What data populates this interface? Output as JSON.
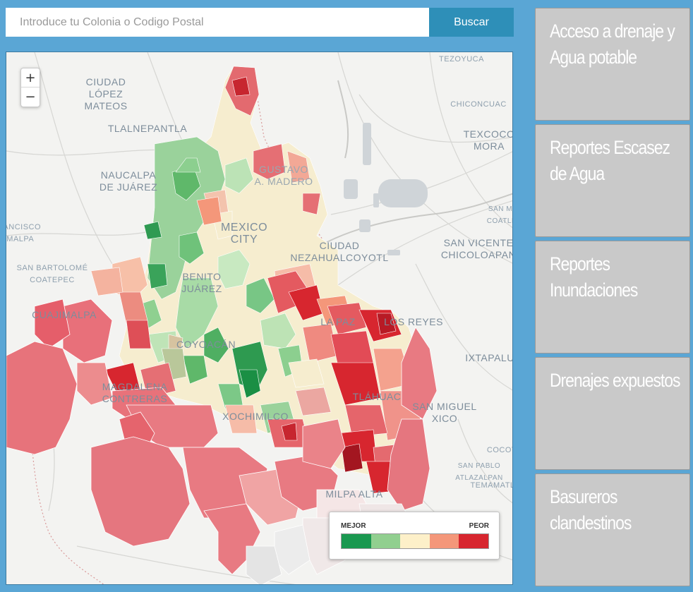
{
  "search": {
    "placeholder": "Introduce tu Colonia o Codigo Postal",
    "button_label": "Buscar"
  },
  "map": {
    "zoom_in_label": "+",
    "zoom_out_label": "−",
    "place_labels": {
      "ciudad_lopez_mateos": "CIUDAD\nLÓPEZ\nMATEOS",
      "tlalnepantla": "TLALNEPANTLA",
      "naucalpan": "NAUCALPA\nDE JUÁREZ",
      "francisco": "RANCISCO\nIMALPA",
      "san_bartolome": "SAN BARTOLOMÉ\nCOATEPEC",
      "cuajimalpa": "CUAJIMALPA",
      "mexico_city": "MEXICO\nCITY",
      "benito_juarez": "BENITO\nJUÁREZ",
      "coyoacan": "COYOACÁN",
      "magdalena": "MAGDALENA\nCONTRERAS",
      "xochimilco": "XOCHIMILCO",
      "ciudad_neza": "CIUDAD\nNEZAHUALCOYOTL",
      "la_paz": "LA PAZ",
      "los_reyes": "LOS REYES",
      "tlahuac": "TLÁHUAC",
      "milpa_alta": "MILPA ALTA",
      "tezoyuca": "TEZOYUCA",
      "chiconcuac": "CHICONCUAC",
      "texcoco": "TEXCOCO\nMORA",
      "san_marcos": "SAN M\nCOATLI",
      "san_vicente": "SAN VICENTE\nCHICOLOAPAN",
      "ixtapaluca": "IXTAPALU",
      "san_miguel": "SAN MIGUEL\nXICO",
      "cocotitlan": "COCOT",
      "san_pablo": "SAN PABLO\nATLAZALPAN",
      "temamatla": "TEMAMATL",
      "gustavo": "GUSTAVO\nA. MADERO"
    },
    "legend": {
      "best_label": "MEJOR",
      "worst_label": "PEOR",
      "colors": [
        "#1a9850",
        "#91cf8f",
        "#fdf0c9",
        "#f4977a",
        "#d7262f"
      ]
    }
  },
  "panels": [
    {
      "title": "Acceso a drenaje y Agua potable"
    },
    {
      "title": "Reportes Escasez de Agua"
    },
    {
      "title": "Reportes Inundaciones"
    },
    {
      "title": "Drenajes expuestos"
    },
    {
      "title": "Basureros clandestinos"
    }
  ]
}
